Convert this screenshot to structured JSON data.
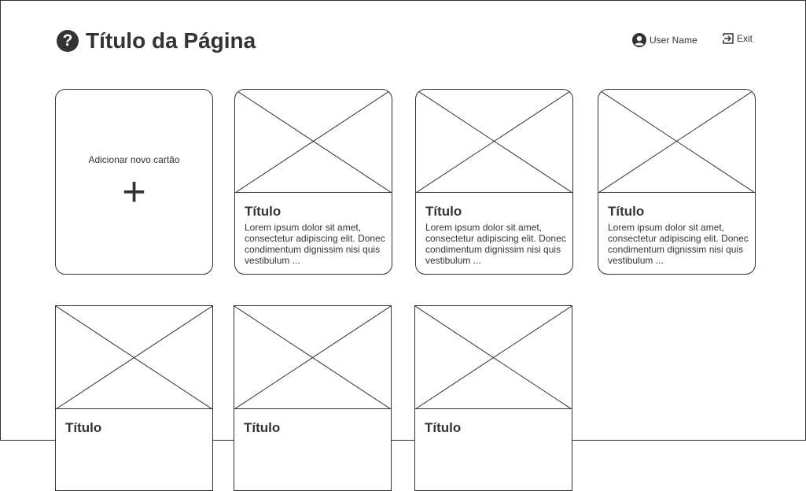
{
  "header": {
    "title": "Título da Página",
    "help_icon": "question-circle-icon",
    "user_name": "User Name",
    "user_icon": "user-circle-icon",
    "exit_label": "Exit",
    "exit_icon": "sign-out-icon"
  },
  "add_card": {
    "label": "Adicionar novo cartão",
    "icon": "+"
  },
  "cards": [
    {
      "title": "Título",
      "text": "Lorem ipsum dolor sit amet, consectetur adipiscing elit. Donec condimentum dignissim nisi quis vestibulum ..."
    },
    {
      "title": "Título",
      "text": "Lorem ipsum dolor sit amet, consectetur adipiscing elit. Donec condimentum dignissim nisi quis vestibulum ..."
    },
    {
      "title": "Título",
      "text": "Lorem ipsum dolor sit amet, consectetur adipiscing elit. Donec condimentum dignissim nisi quis vestibulum ..."
    },
    {
      "title": "Título",
      "text": ""
    },
    {
      "title": "Título",
      "text": ""
    },
    {
      "title": "Título",
      "text": ""
    }
  ],
  "colors": {
    "ink": "#333333",
    "background": "#ffffff"
  }
}
